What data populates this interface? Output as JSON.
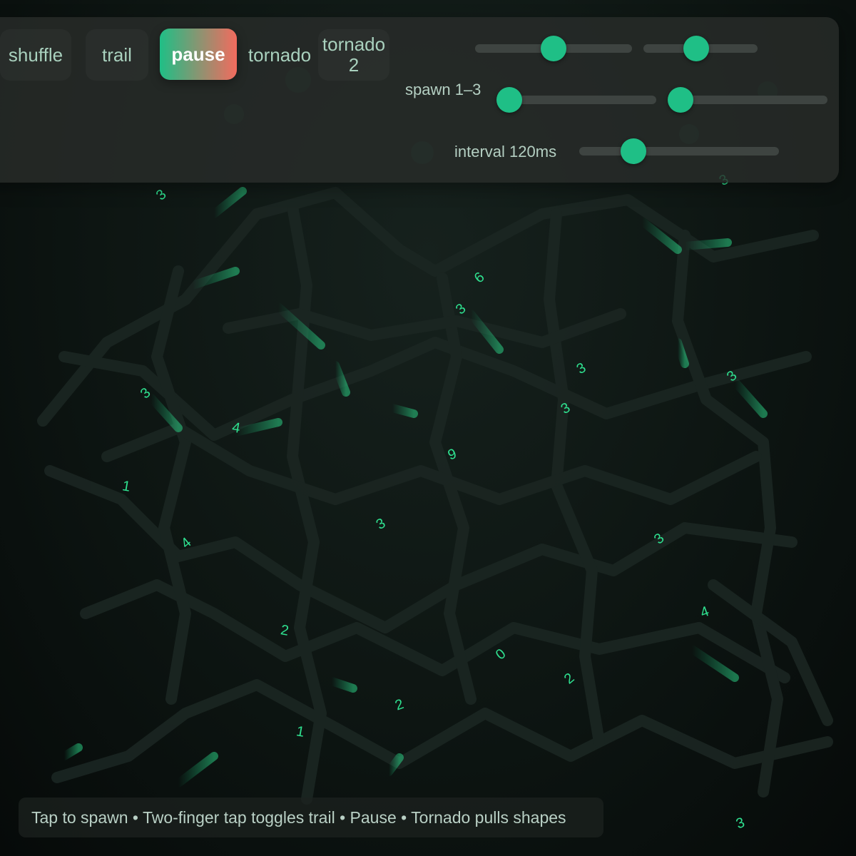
{
  "toolbar": {
    "shuffle_label": "shuffle",
    "trail_label": "trail",
    "pause_label": "pause",
    "tornado_label": "tornado",
    "tornado2_label": "tornado 2"
  },
  "sliders": {
    "top_left_value": 0.5,
    "top_right_value": 0.46,
    "spawn": {
      "label": "spawn 1–3",
      "min_value": 0.08,
      "max_value": 0.08
    },
    "interval": {
      "label": "interval 120ms",
      "value": 0.27
    }
  },
  "hint": "Tap to spawn • Two-finger tap toggles trail • Pause • Tornado pulls shapes",
  "colors": {
    "accent": "#1fbf86",
    "pause_gradient_start": "#1fbf86",
    "pause_gradient_end": "#f26b5e",
    "shape_glyph": "#2fe08f"
  },
  "shapes": [
    "3",
    "3",
    "6",
    "3",
    "3",
    "3",
    "3",
    "9",
    "4",
    "3",
    "1",
    "3",
    "4",
    "3",
    "2",
    "0",
    "2",
    "4",
    "2",
    "3",
    "1"
  ]
}
